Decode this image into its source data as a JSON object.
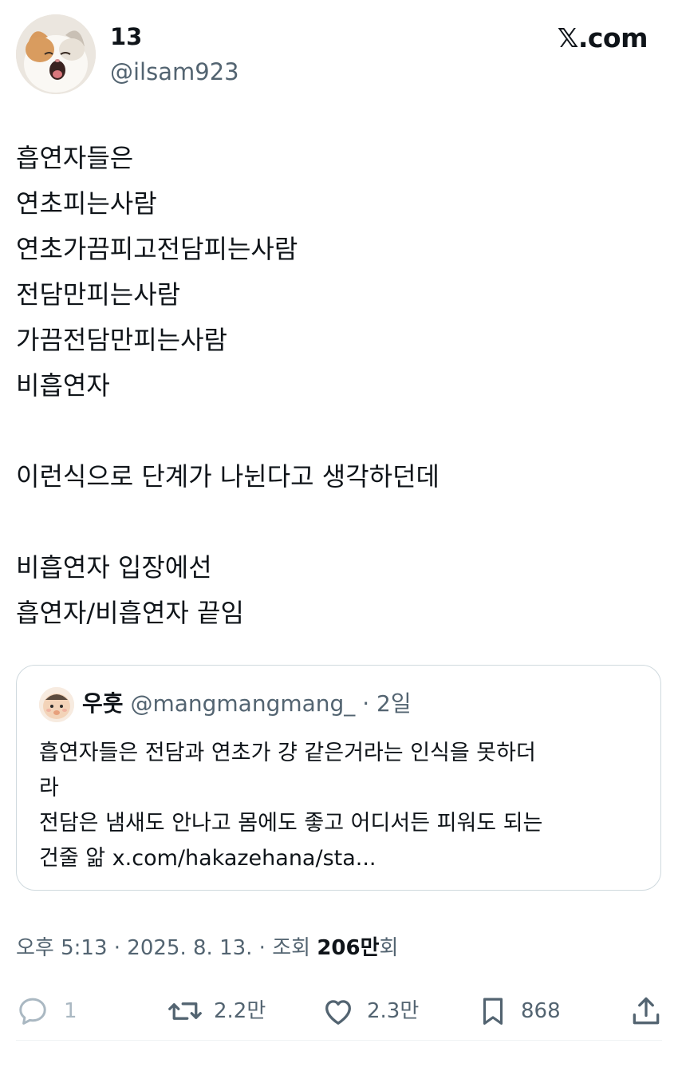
{
  "author": {
    "display_name": "13",
    "handle": "@ilsam923"
  },
  "brand": "𝕏.com",
  "tweet": {
    "lines": [
      "흡연자들은",
      "연초피는사람",
      "연초가끔피고전담피는사람",
      "전담만피는사람",
      "가끔전담만피는사람",
      "비흡연자",
      "",
      "이런식으로 단계가 나뉜다고 생각하던데",
      "",
      "비흡연자 입장에선",
      "흡연자/비흡연자 끝임"
    ]
  },
  "quote": {
    "name": "우훗",
    "handle": "@mangmangmang_",
    "separator": "·",
    "time": "2일",
    "lines": [
      "흡연자들은 전담과 연초가 걍 같은거라는 인식을 못하더",
      "라",
      "전담은 냄새도 안나고 몸에도 좋고 어디서든 피워도 되는",
      "건줄 앎 x.com/hakazehana/sta..."
    ]
  },
  "meta": {
    "time": "오후 5:13",
    "sep1": " · ",
    "date": "2025. 8. 13.",
    "sep2": " · ",
    "views_label": "조회 ",
    "views_count": "206만",
    "views_suffix": "회"
  },
  "actions": {
    "reply_count": "1",
    "retweet_count": "2.2만",
    "like_count": "2.3만",
    "bookmark_count": "868"
  },
  "icons": {
    "reply": "reply-icon",
    "retweet": "retweet-icon",
    "like": "heart-icon",
    "bookmark": "bookmark-icon",
    "share": "share-icon"
  },
  "colors": {
    "text": "#0f1419",
    "secondary": "#536471",
    "border": "#cfd9de"
  }
}
